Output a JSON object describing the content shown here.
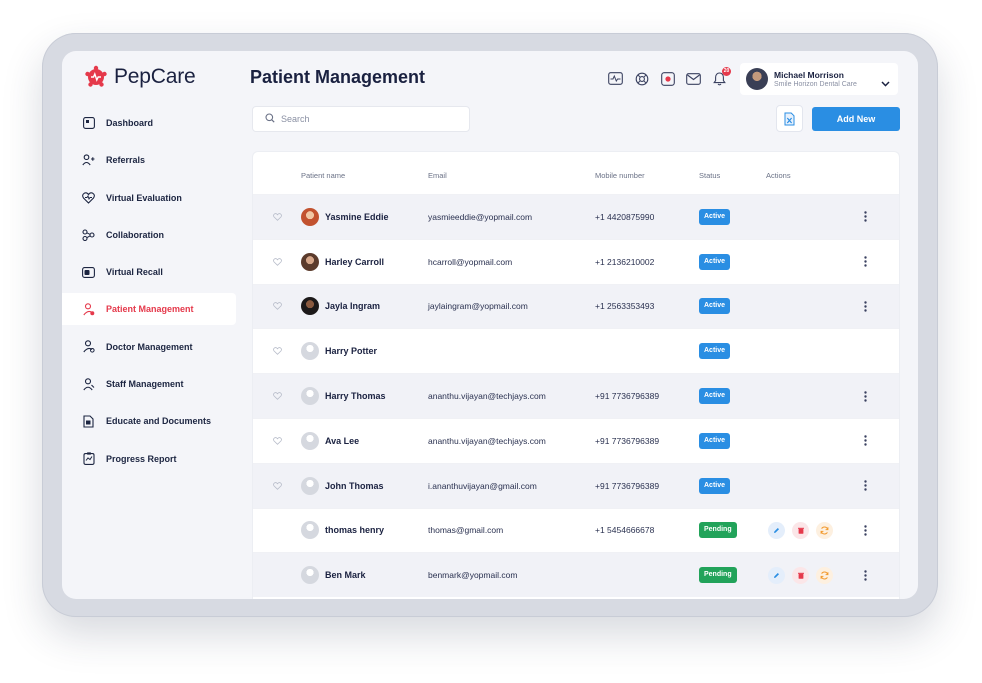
{
  "app": {
    "name": "PepCare",
    "colors": {
      "brand": "#e5394b",
      "primary": "#2a8ee3",
      "pending": "#22a35a"
    }
  },
  "sidebar": {
    "items": [
      {
        "label": "Dashboard",
        "icon": "dashboard-icon",
        "active": false
      },
      {
        "label": "Referrals",
        "icon": "referrals-icon",
        "active": false
      },
      {
        "label": "Virtual Evaluation",
        "icon": "heart-monitor-icon",
        "active": false
      },
      {
        "label": "Collaboration",
        "icon": "collaboration-icon",
        "active": false
      },
      {
        "label": "Virtual Recall",
        "icon": "recall-icon",
        "active": false
      },
      {
        "label": "Patient Management",
        "icon": "patient-icon",
        "active": true
      },
      {
        "label": "Doctor Management",
        "icon": "doctor-icon",
        "active": false
      },
      {
        "label": "Staff Management",
        "icon": "staff-icon",
        "active": false
      },
      {
        "label": "Educate and Documents",
        "icon": "documents-icon",
        "active": false
      },
      {
        "label": "Progress Report",
        "icon": "report-icon",
        "active": false
      }
    ]
  },
  "header": {
    "title": "Patient Management",
    "icons": [
      "activity-icon",
      "support-icon",
      "record-icon",
      "mail-icon",
      "bell-icon"
    ],
    "notification_count": "20",
    "user": {
      "name": "Michael Morrison",
      "org": "Smile Horizon Dental Care"
    }
  },
  "toolbar": {
    "search_placeholder": "Search",
    "add_label": "Add New"
  },
  "table": {
    "columns": [
      "Patient name",
      "Email",
      "Mobile number",
      "Status",
      "Actions"
    ],
    "rows": [
      {
        "name": "Yasmine Eddie",
        "email": "yasmieeddie@yopmail.com",
        "mobile": "+1 4420875990",
        "status": "Active",
        "avatar": "av-photo1",
        "favorite": true,
        "actions": false,
        "menu": true
      },
      {
        "name": "Harley Carroll",
        "email": "hcarroll@yopmail.com",
        "mobile": "+1 2136210002",
        "status": "Active",
        "avatar": "av-photo2",
        "favorite": true,
        "actions": false,
        "menu": true
      },
      {
        "name": "Jayla Ingram",
        "email": "jaylaingram@yopmail.com",
        "mobile": "+1 2563353493",
        "status": "Active",
        "avatar": "av-photo3",
        "favorite": true,
        "actions": false,
        "menu": true
      },
      {
        "name": "Harry Potter",
        "email": "",
        "mobile": "",
        "status": "Active",
        "avatar": "av-default",
        "favorite": true,
        "actions": false,
        "menu": false
      },
      {
        "name": "Harry Thomas",
        "email": "ananthu.vijayan@techjays.com",
        "mobile": "+91 7736796389",
        "status": "Active",
        "avatar": "av-default",
        "favorite": true,
        "actions": false,
        "menu": true
      },
      {
        "name": "Ava Lee",
        "email": "ananthu.vijayan@techjays.com",
        "mobile": "+91 7736796389",
        "status": "Active",
        "avatar": "av-default",
        "favorite": true,
        "actions": false,
        "menu": true
      },
      {
        "name": "John Thomas",
        "email": "i.ananthuvijayan@gmail.com",
        "mobile": "+91 7736796389",
        "status": "Active",
        "avatar": "av-default",
        "favorite": true,
        "actions": false,
        "menu": true
      },
      {
        "name": "thomas henry",
        "email": "thomas@gmail.com",
        "mobile": "+1 5454666678",
        "status": "Pending",
        "avatar": "av-default",
        "favorite": false,
        "actions": true,
        "menu": true
      },
      {
        "name": "Ben Mark",
        "email": "benmark@yopmail.com",
        "mobile": "",
        "status": "Pending",
        "avatar": "av-default",
        "favorite": false,
        "actions": true,
        "menu": true
      }
    ]
  }
}
